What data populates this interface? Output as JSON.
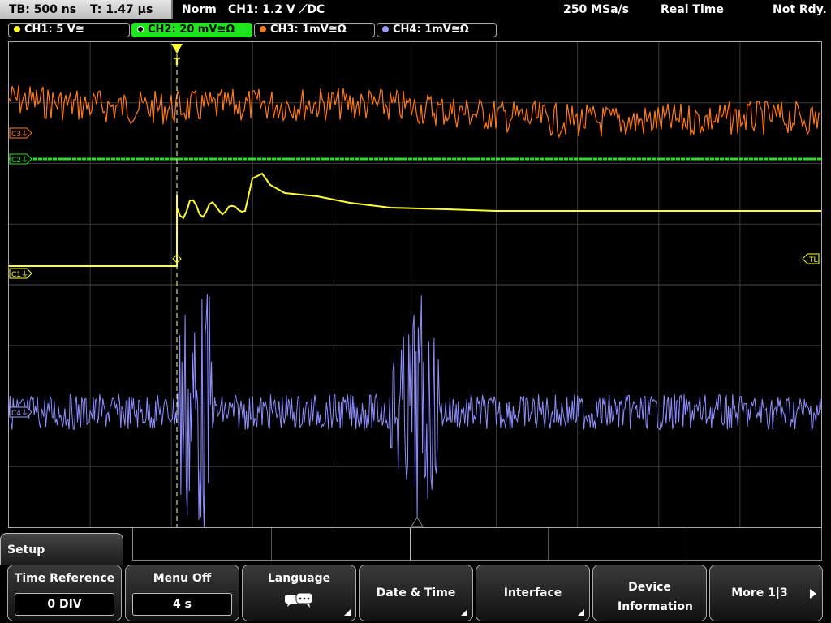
{
  "topbar": {
    "timebase": "TB: 500 ns",
    "trigger_time": "T: 1.47 µs",
    "mode": "Norm",
    "trigger_info": "CH1: 1.2 V ⟋DC",
    "sample_rate": "250 MSa/s",
    "acq_mode": "Real Time",
    "status": "Not Rdy."
  },
  "channels": [
    {
      "label": "CH1: 5 V≅",
      "color": "#ffff33",
      "active": false
    },
    {
      "label": "CH2: 20 mV≅Ω",
      "color": "#1ee51e",
      "active": true
    },
    {
      "label": "CH3: 1mV≅Ω",
      "color": "#ff7a1a",
      "active": false
    },
    {
      "label": "CH4: 1mV≅Ω",
      "color": "#9b9bff",
      "active": false
    }
  ],
  "markers": {
    "c3": "C3⏚",
    "c2": "C2⏚",
    "c1": "C1⏚",
    "c4": "C4⏚",
    "trigger_level": "TL",
    "trigger_pos": "T"
  },
  "menu": {
    "title": "Setup",
    "softkeys": [
      {
        "label": "Time Reference",
        "value": "0 DIV"
      },
      {
        "label": "Menu Off",
        "value": "4 s"
      },
      {
        "label": "Language",
        "icon": "speech-bubbles-icon"
      },
      {
        "label": "Date & Time"
      },
      {
        "label": "Interface"
      },
      {
        "label": "Device Information"
      },
      {
        "label": "More 1|3",
        "icon": "arrow-right-icon"
      }
    ]
  }
}
